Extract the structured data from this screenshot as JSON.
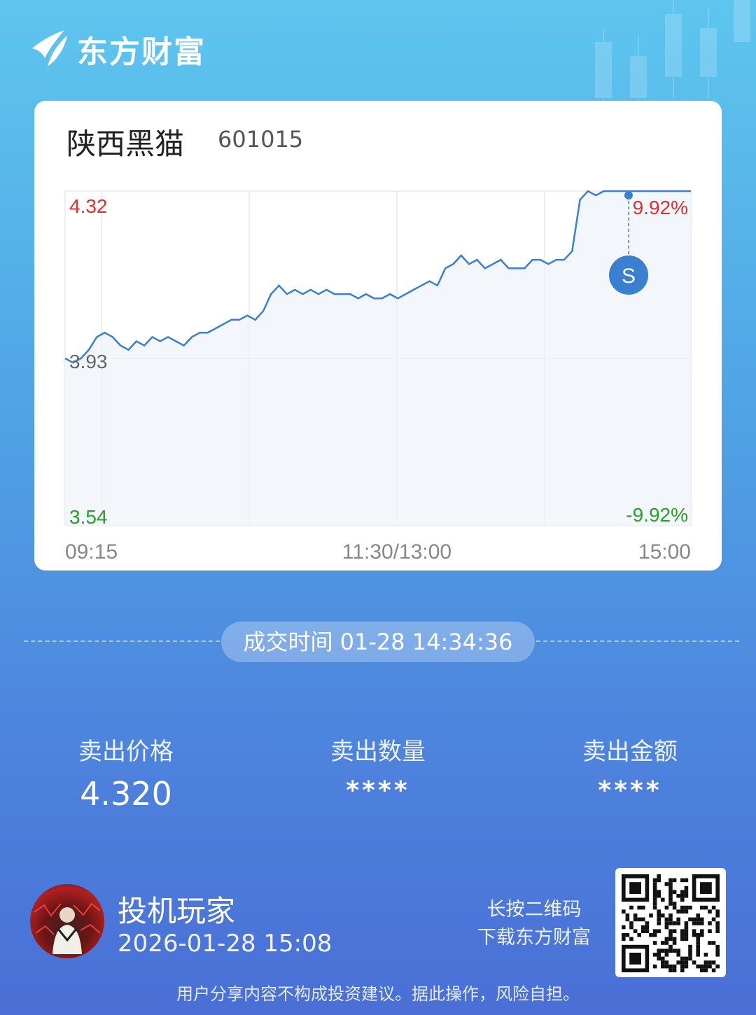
{
  "brand": {
    "name": "东方财富",
    "logo_icon": "eastmoney-logo-icon"
  },
  "stock": {
    "name": "陕西黑猫",
    "code": "601015"
  },
  "chart": {
    "y_max_label": "4.32",
    "y_mid_label": "3.93",
    "y_min_label": "3.54",
    "pct_max_label": "9.92%",
    "pct_min_label": "-9.92%",
    "x_labels": [
      "09:15",
      "11:30/13:00",
      "15:00"
    ],
    "sell_marker": "S",
    "up_color": "#e03030",
    "down_color": "#2aa02a",
    "line_color": "#3a7fd0"
  },
  "chart_data": {
    "type": "line",
    "title": "",
    "ylim": [
      3.54,
      4.32
    ],
    "x_ticks": [
      "09:15",
      "11:30/13:00",
      "15:00"
    ],
    "series": [
      {
        "values": [
          3.93,
          3.92,
          3.93,
          3.95,
          3.98,
          3.99,
          3.98,
          3.96,
          3.95,
          3.97,
          3.96,
          3.98,
          3.97,
          3.98,
          3.97,
          3.96,
          3.98,
          3.99,
          3.99,
          4.0,
          4.01,
          4.02,
          4.02,
          4.03,
          4.02,
          4.04,
          4.08,
          4.1,
          4.08,
          4.09,
          4.08,
          4.09,
          4.08,
          4.09,
          4.08,
          4.08,
          4.08,
          4.07,
          4.08,
          4.07,
          4.07,
          4.08,
          4.07,
          4.08,
          4.09,
          4.1,
          4.11,
          4.1,
          4.14,
          4.15,
          4.17,
          4.15,
          4.16,
          4.14,
          4.15,
          4.16,
          4.14,
          4.14,
          4.14,
          4.16,
          4.16,
          4.15,
          4.16,
          4.16,
          4.18,
          4.3,
          4.32,
          4.31,
          4.32,
          4.32,
          4.32,
          4.32,
          4.32,
          4.32,
          4.32,
          4.32,
          4.32,
          4.32,
          4.32,
          4.32
        ]
      }
    ],
    "sell_point": {
      "time": "14:34:36",
      "price": 4.32
    }
  },
  "trade": {
    "time_label": "成交时间 01-28 14:34:36"
  },
  "stats": [
    {
      "label": "卖出价格",
      "value": "4.320"
    },
    {
      "label": "卖出数量",
      "value": "****"
    },
    {
      "label": "卖出金额",
      "value": "****"
    }
  ],
  "user": {
    "name": "投机玩家",
    "time": "2026-01-28 15:08",
    "avatar_icon": "avatar-image"
  },
  "qr": {
    "hint_line1": "长按二维码",
    "hint_line2": "下载东方财富",
    "icon": "qr-code-icon"
  },
  "disclaimer": "用户分享内容不构成投资建议。据此操作，风险自担。"
}
